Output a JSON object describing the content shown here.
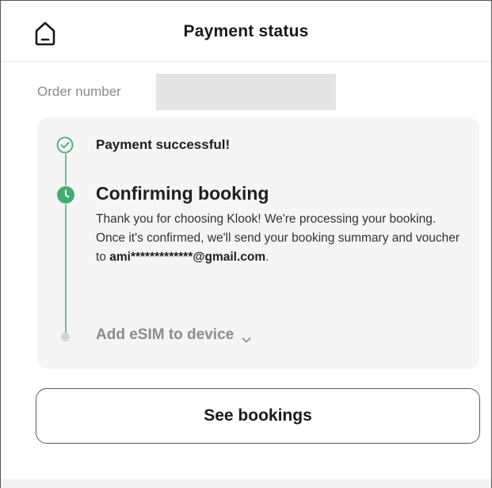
{
  "header": {
    "title": "Payment status",
    "home_icon": "home-icon"
  },
  "order": {
    "label": "Order number"
  },
  "timeline": {
    "step1": {
      "label": "Payment successful!",
      "status": "complete",
      "icon": "check-circle-icon"
    },
    "step2": {
      "label": "Confirming booking",
      "status": "in-progress",
      "icon": "clock-icon",
      "description_before": "Thank you for choosing Klook! We're processing your booking. Once it's confirmed, we'll send your booking summary and voucher to ",
      "email": "ami*************@gmail.com",
      "description_after": "."
    },
    "step3": {
      "label": "Add eSIM to device",
      "status": "pending",
      "icon": "chevron-down-icon"
    }
  },
  "actions": {
    "see_bookings_label": "See bookings"
  },
  "colors": {
    "accent_green": "#3fae6f",
    "card_bg": "#f5f5f5",
    "pending_grey": "#d4d4d4"
  }
}
